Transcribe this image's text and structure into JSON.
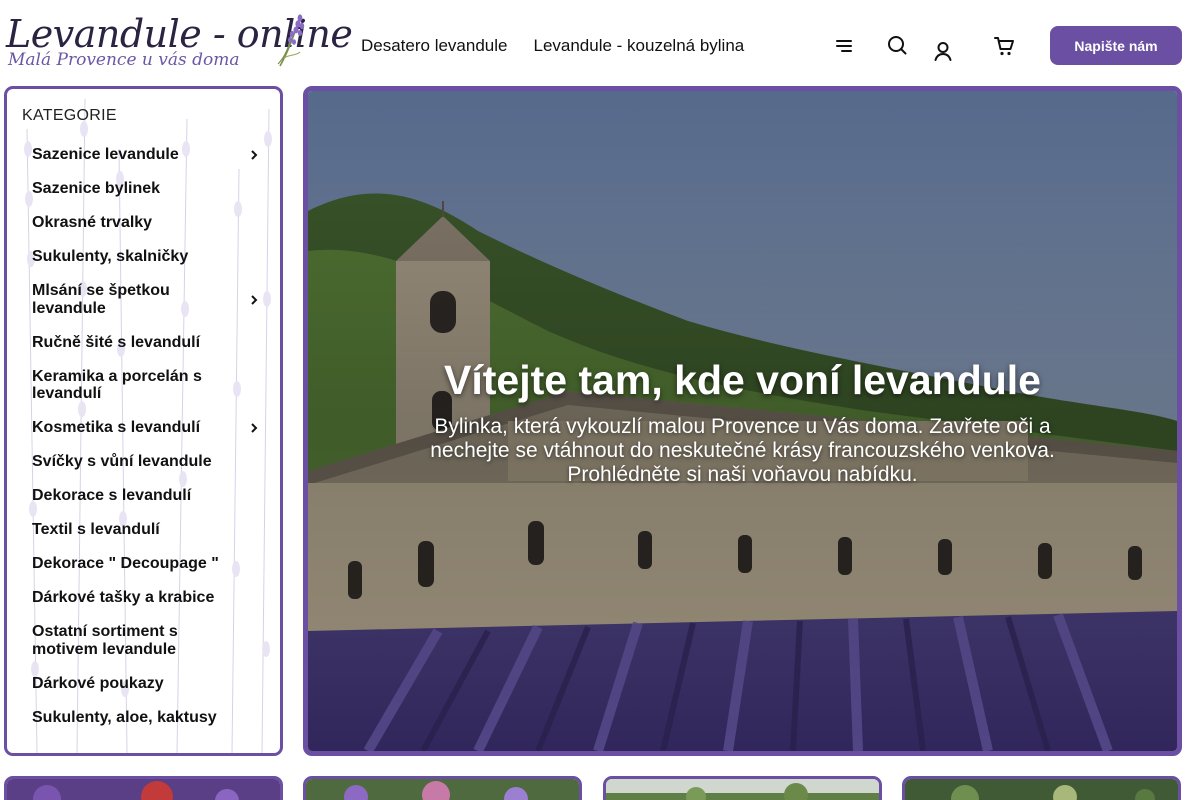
{
  "logo": {
    "title": "Levandule - online",
    "subtitle": "Malá Provence u vás doma"
  },
  "nav": {
    "items": [
      "Desatero levandule",
      "Levandule - kouzelná bylina"
    ]
  },
  "header_icons": [
    "menu-icon",
    "search-icon",
    "user-icon",
    "cart-icon"
  ],
  "contact_button": "Napište nám",
  "sidebar": {
    "title": "KATEGORIE",
    "items": [
      {
        "label": "Sazenice levandule",
        "has_sub": true
      },
      {
        "label": "Sazenice bylinek",
        "has_sub": false
      },
      {
        "label": "Okrasné trvalky",
        "has_sub": false
      },
      {
        "label": "Sukulenty, skalničky",
        "has_sub": false
      },
      {
        "label": "Mlsání se špetkou levandule",
        "has_sub": true
      },
      {
        "label": "Ručně šité s levandulí",
        "has_sub": false
      },
      {
        "label": "Keramika a porcelán s levandulí",
        "has_sub": false
      },
      {
        "label": "Kosmetika s levandulí",
        "has_sub": true
      },
      {
        "label": "Svíčky s vůní levandule",
        "has_sub": false
      },
      {
        "label": "Dekorace s levandulí",
        "has_sub": false
      },
      {
        "label": "Textil s levandulí",
        "has_sub": false
      },
      {
        "label": "Dekorace \" Decoupage \"",
        "has_sub": false
      },
      {
        "label": "Dárkové tašky a krabice",
        "has_sub": false
      },
      {
        "label": "Ostatní sortiment s motivem levandule",
        "has_sub": false
      },
      {
        "label": "Dárkové poukazy",
        "has_sub": false
      },
      {
        "label": "Sukulenty, aloe, kaktusy",
        "has_sub": false
      }
    ]
  },
  "hero": {
    "title": "Vítejte tam, kde voní levandule",
    "text": "Bylinka, která vykouzlí malou Provence u Vás doma. Zavřete oči a nechejte se vtáhnout do neskutečné krásy francouzského venkova. Prohlédněte si naši voňavou nabídku."
  },
  "colors": {
    "accent": "#6b4fa3",
    "text": "#111111"
  }
}
